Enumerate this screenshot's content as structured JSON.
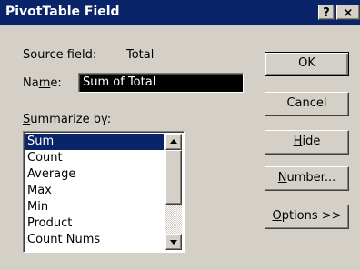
{
  "window": {
    "title": "PivotTable Field",
    "help_label": "?",
    "close_label": "×"
  },
  "source": {
    "label": "Source field:",
    "value": "Total"
  },
  "name": {
    "pre": "Na",
    "accel": "m",
    "post": "e:",
    "value": "Sum of Total"
  },
  "summarize": {
    "accel": "S",
    "post": "ummarize by:",
    "items": [
      "Sum",
      "Count",
      "Average",
      "Max",
      "Min",
      "Product",
      "Count Nums"
    ],
    "selected": "Sum"
  },
  "buttons": {
    "ok": "OK",
    "cancel": "Cancel",
    "hide_accel": "H",
    "hide_rest": "ide",
    "number_accel": "N",
    "number_rest": "umber...",
    "options_accel": "O",
    "options_rest": "ptions >>"
  }
}
